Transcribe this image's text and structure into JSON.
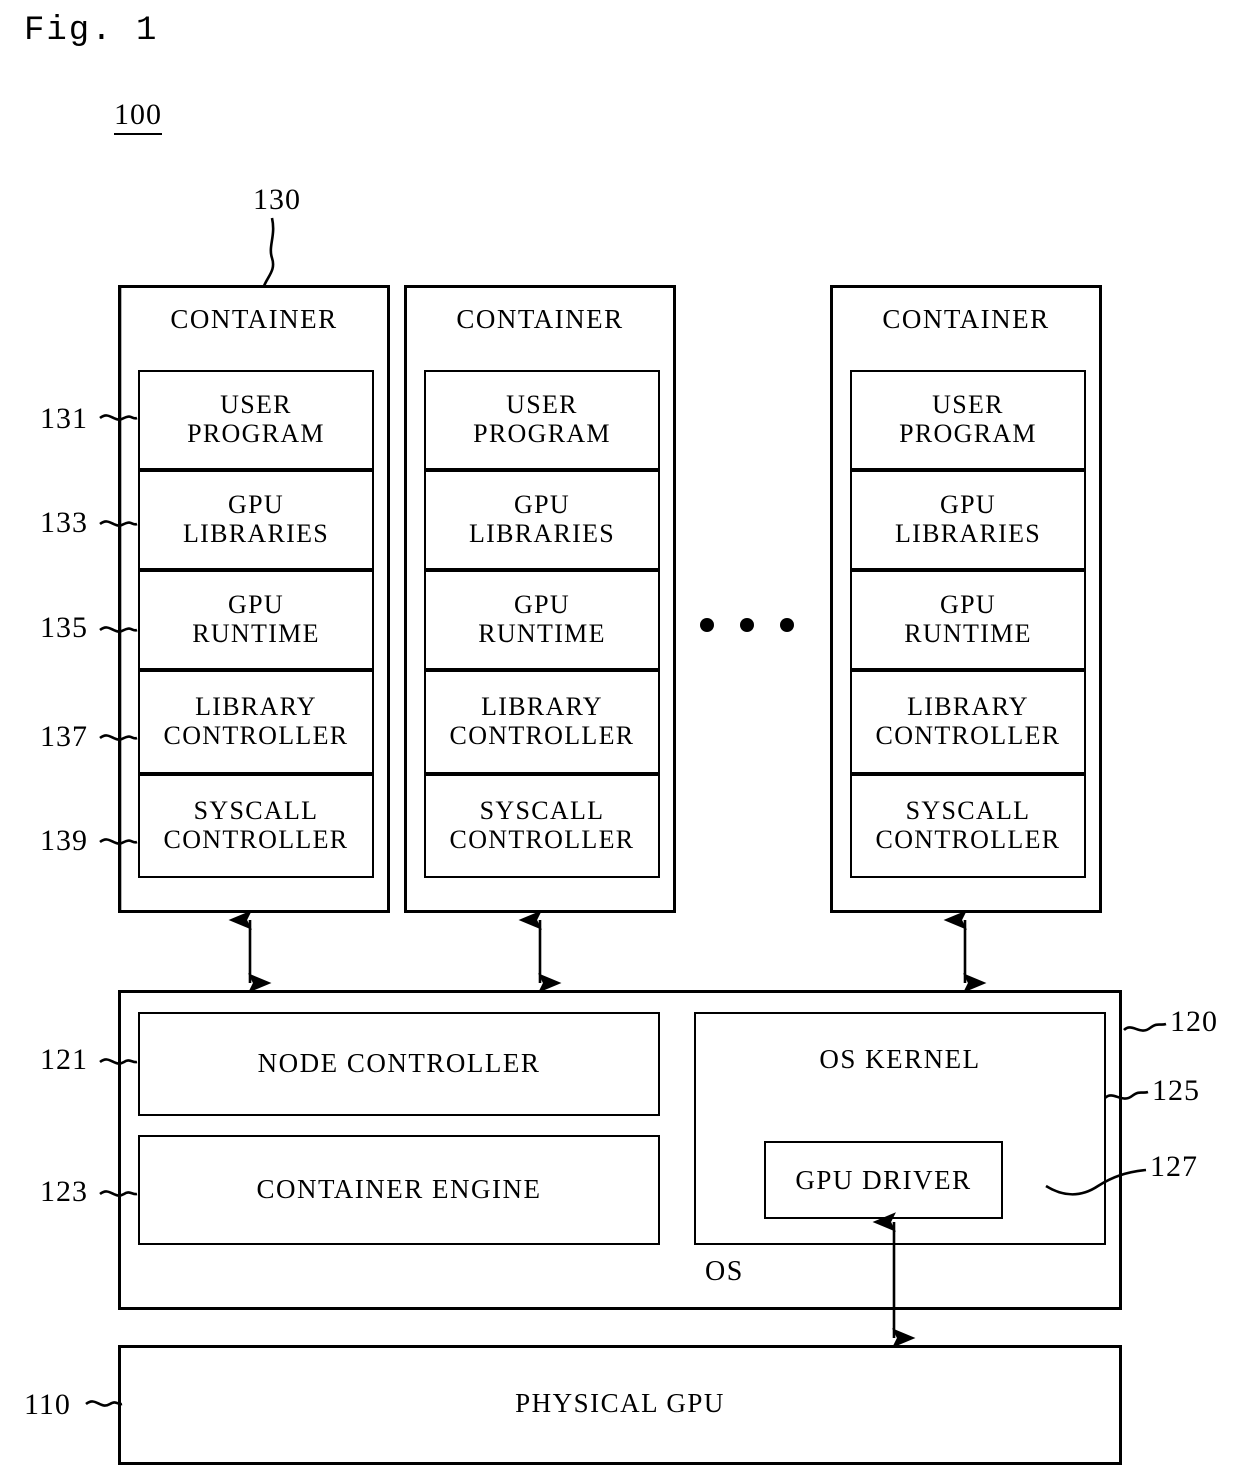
{
  "figure": {
    "caption": "Fig. 1",
    "system_ref": "100"
  },
  "containers": {
    "title": "CONTAINER",
    "ref": "130",
    "layers": [
      {
        "ref": "131",
        "label": "USER\nPROGRAM"
      },
      {
        "ref": "133",
        "label": "GPU\nLIBRARIES"
      },
      {
        "ref": "135",
        "label": "GPU\nRUNTIME"
      },
      {
        "ref": "137",
        "label": "LIBRARY\nCONTROLLER"
      },
      {
        "ref": "139",
        "label": "SYSCALL\nCONTROLLER"
      }
    ],
    "instances": [
      {
        "title": "CONTAINER"
      },
      {
        "title": "CONTAINER"
      },
      {
        "title": "CONTAINER"
      }
    ],
    "ellipsis": "..."
  },
  "os": {
    "ref": "120",
    "word": "OS",
    "node_controller": {
      "ref": "121",
      "label": "NODE CONTROLLER"
    },
    "container_engine": {
      "ref": "123",
      "label": "CONTAINER ENGINE"
    },
    "kernel": {
      "ref": "125",
      "label": "OS KERNEL"
    },
    "gpu_driver": {
      "ref": "127",
      "label": "GPU DRIVER"
    }
  },
  "hardware": {
    "ref": "110",
    "label": "PHYSICAL GPU"
  },
  "colors": {
    "stroke": "#000000",
    "background": "#ffffff"
  }
}
